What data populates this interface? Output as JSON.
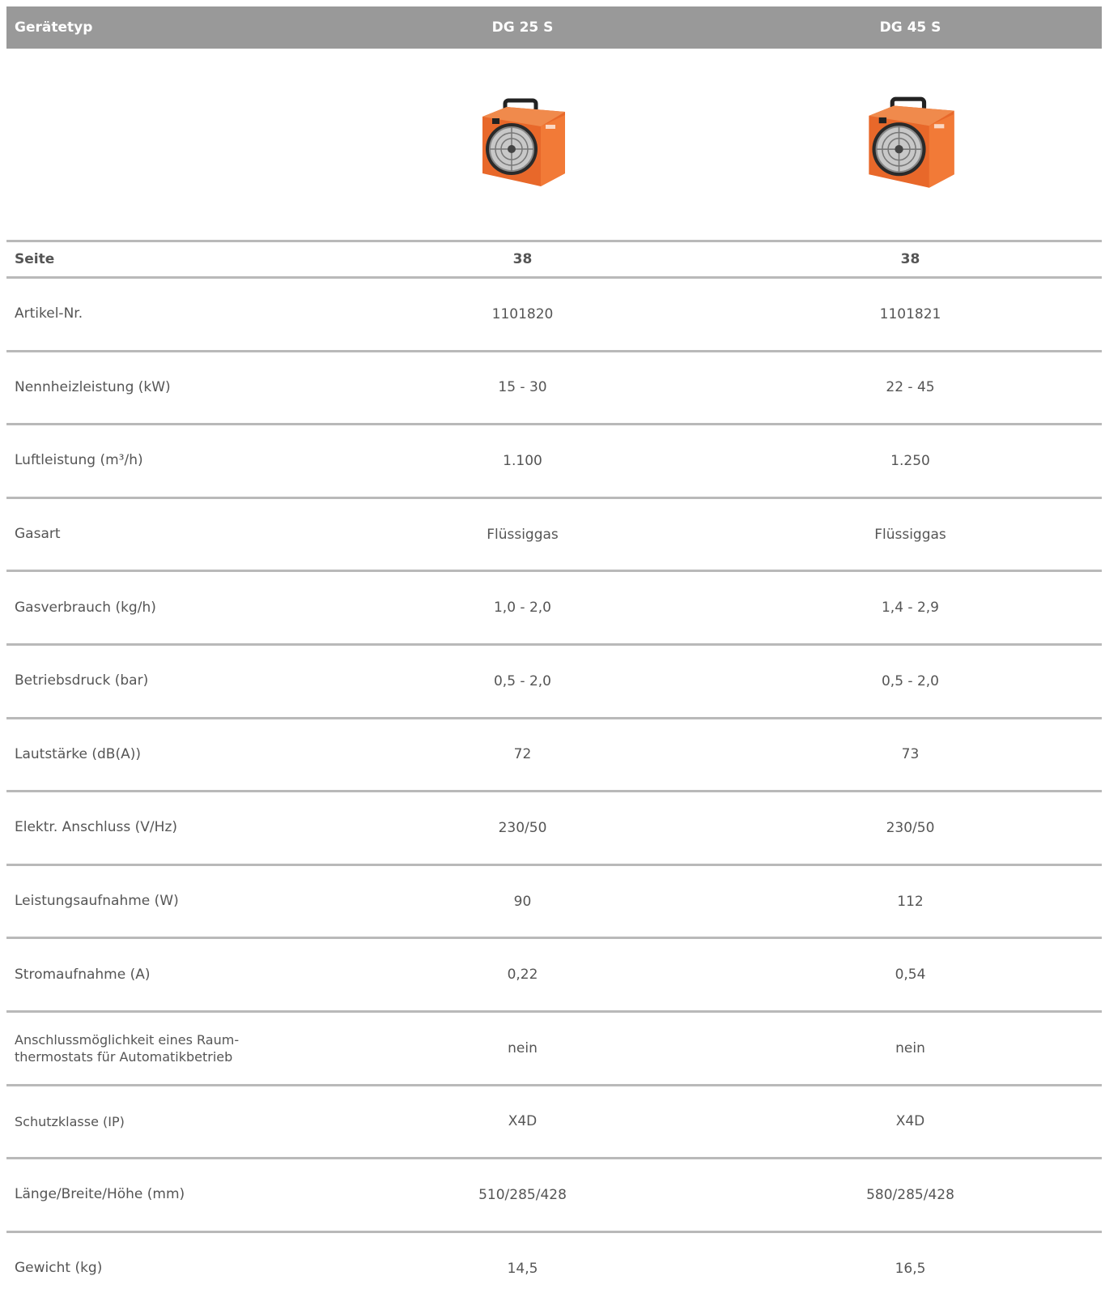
{
  "header": {
    "label": "Gerätetyp",
    "model_a": "DG 25 S",
    "model_b": "DG 45 S"
  },
  "images": {
    "model_a": "heater-icon",
    "model_b": "heater-icon"
  },
  "page_row": {
    "label": "Seite",
    "a": "38",
    "b": "38"
  },
  "rows": [
    {
      "label": "Artikel-Nr.",
      "a": "1101820",
      "b": "1101821"
    },
    {
      "label": "Nennheizleistung (kW)",
      "a": "15 - 30",
      "b": "22 - 45"
    },
    {
      "label": "Luftleistung (m³/h)",
      "a": "1.100",
      "b": "1.250"
    },
    {
      "label": "Gasart",
      "a": "Flüssiggas",
      "b": "Flüssiggas"
    },
    {
      "label": "Gasverbrauch (kg/h)",
      "a": "1,0 - 2,0",
      "b": "1,4 - 2,9"
    },
    {
      "label": "Betriebsdruck (bar)",
      "a": "0,5 - 2,0",
      "b": "0,5 - 2,0"
    },
    {
      "label": "Lautstärke (dB(A))",
      "a": "72",
      "b": "73"
    },
    {
      "label": "Elektr. Anschluss (V/Hz)",
      "a": "230/50",
      "b": "230/50"
    },
    {
      "label": "Leistungsaufnahme (W)",
      "a": "90",
      "b": "112"
    },
    {
      "label": "Stromaufnahme (A)",
      "a": "0,22",
      "b": "0,54"
    },
    {
      "label_line1": "Anschlussmöglichkeit eines Raum-",
      "label_line2": "thermostats für Automatikbetrieb",
      "a": "nein",
      "b": "nein"
    },
    {
      "label": "Schutzklasse (IP)",
      "a": "X4D",
      "b": "X4D"
    },
    {
      "label": "Länge/Breite/Höhe (mm)",
      "a": "510/285/428",
      "b": "580/285/428"
    },
    {
      "label": "Gewicht (kg)",
      "a": "14,5",
      "b": "16,5"
    }
  ]
}
